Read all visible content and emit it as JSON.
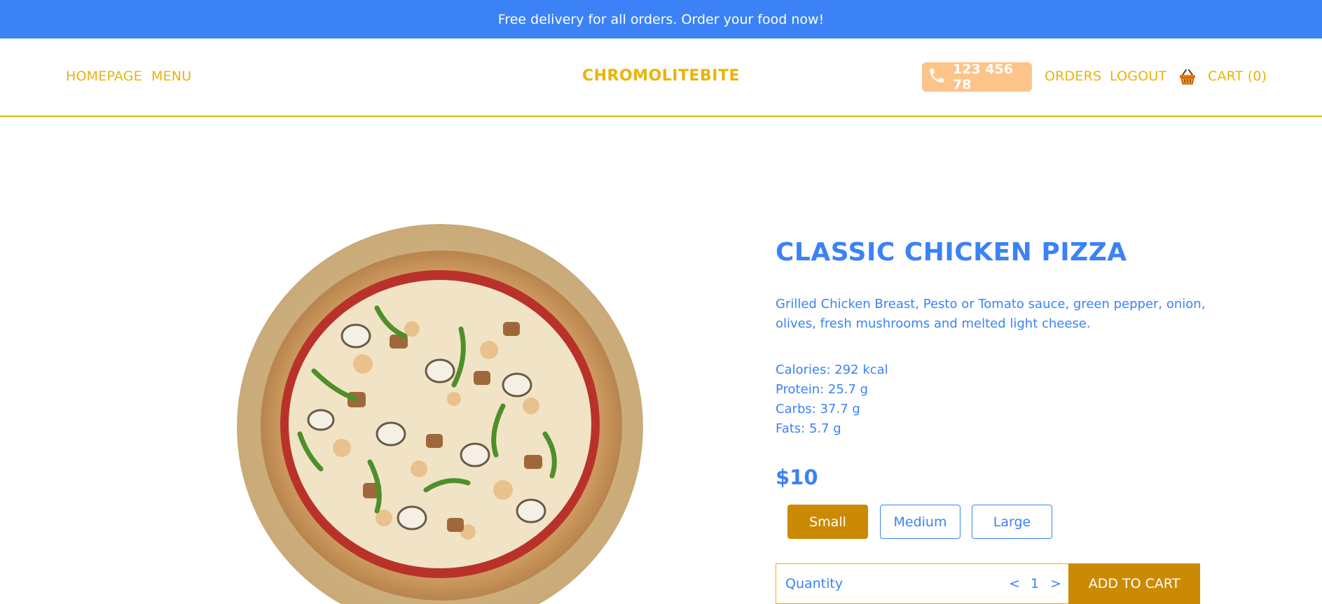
{
  "promo": {
    "text": "Free delivery for all orders. Order your food now!"
  },
  "nav": {
    "homepage": "HOMEPAGE",
    "menu": "MENU",
    "brand": "CHROMOLITEBITE",
    "phone": "123 456 78",
    "orders": "ORDERS",
    "logout": "LOGOUT",
    "cart": "CART (0)",
    "icons": {
      "phone": "phone-icon",
      "basket": "basket-icon"
    }
  },
  "product": {
    "title": "CLASSIC CHICKEN PIZZA",
    "description": "Grilled Chicken Breast, Pesto or Tomato sauce, green pepper, onion, olives, fresh mushrooms and melted light cheese.",
    "nutrition": {
      "calories": "Calories: 292 kcal",
      "protein": "Protein: 25.7 g",
      "carbs": "Carbs: 37.7 g",
      "fats": "Fats: 5.7 g"
    },
    "price": "$10",
    "sizes": [
      "Small",
      "Medium",
      "Large"
    ],
    "selected_size": "Small",
    "quantity": {
      "label": "Quantity",
      "decrement": "<",
      "value": "1",
      "increment": ">"
    },
    "add_to_cart": "ADD TO CART"
  },
  "colors": {
    "primary_blue": "#3b82f6",
    "accent_yellow": "#eab308",
    "button_gold": "#ca8a04",
    "phone_badge": "#fdc48a"
  }
}
